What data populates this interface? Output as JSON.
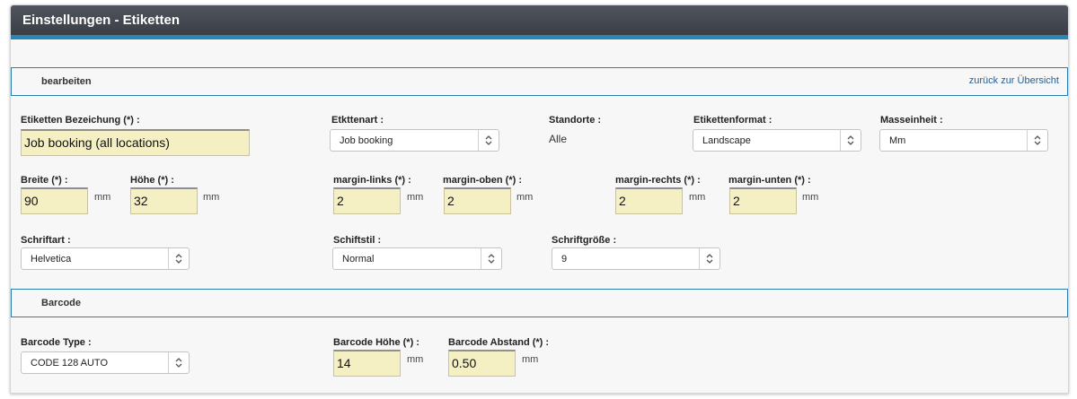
{
  "window": {
    "title": "Einstellungen - Etiketten"
  },
  "edit_section": {
    "title": "bearbeiten",
    "back_link": "zurück zur Übersicht"
  },
  "form": {
    "bezeichnung": {
      "label": "Etiketten Bezeichung (*) :",
      "value": "Job booking (all locations)"
    },
    "etikettenart": {
      "label": "Etkttenart :",
      "value": "Job booking"
    },
    "standorte": {
      "label": "Standorte :",
      "value": "Alle"
    },
    "etikettenformat": {
      "label": "Etikettenformat :",
      "value": "Landscape"
    },
    "masseinheit": {
      "label": "Masseinheit :",
      "value": "Mm"
    },
    "breite": {
      "label": "Breite (*) :",
      "value": "90",
      "unit": "mm"
    },
    "hoehe": {
      "label": "Höhe (*) :",
      "value": "32",
      "unit": "mm"
    },
    "margin_links": {
      "label": "margin-links (*) :",
      "value": "2",
      "unit": "mm"
    },
    "margin_oben": {
      "label": "margin-oben (*) :",
      "value": "2",
      "unit": "mm"
    },
    "margin_rechts": {
      "label": "margin-rechts (*) :",
      "value": "2",
      "unit": "mm"
    },
    "margin_unten": {
      "label": "margin-unten (*) :",
      "value": "2",
      "unit": "mm"
    },
    "schriftart": {
      "label": "Schriftart :",
      "value": "Helvetica"
    },
    "schriftstil": {
      "label": "Schiftstil :",
      "value": "Normal"
    },
    "schriftgroesse": {
      "label": "Schriftgröße :",
      "value": "9"
    }
  },
  "barcode_section": {
    "title": "Barcode"
  },
  "barcode": {
    "type": {
      "label": "Barcode Type :",
      "value": "CODE 128 AUTO"
    },
    "hoehe": {
      "label": "Barcode Höhe (*) :",
      "value": "14",
      "unit": "mm"
    },
    "abstand": {
      "label": "Barcode Abstand (*) :",
      "value": "0.50",
      "unit": "mm"
    }
  },
  "colors": {
    "header": "#3f434a",
    "accent": "#2b86b8",
    "input_bg": "#f5f0c4",
    "link": "#1f5f9a"
  },
  "icons": {
    "select_arrow": "updown-chevron-icon"
  }
}
